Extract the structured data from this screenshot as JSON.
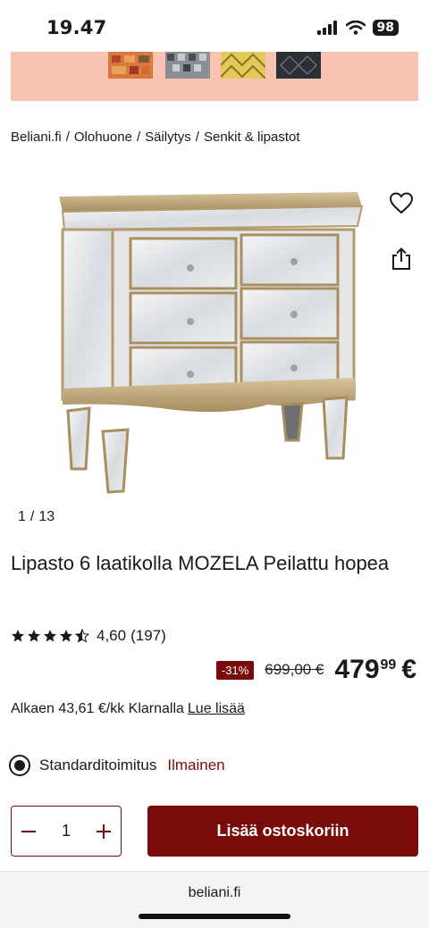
{
  "status_bar": {
    "time": "19.47",
    "battery": "98"
  },
  "breadcrumb": [
    "Beliani.fi",
    "/",
    "Olohuone",
    "/",
    "Säilytys",
    "/",
    "Senkit & lipastot"
  ],
  "gallery": {
    "current": "1",
    "separator": "/",
    "total": "13"
  },
  "product": {
    "title": "Lipasto 6 laatikolla MOZELA Peilattu hopea",
    "rating": "4,60",
    "reviews": "(197)",
    "rating_value": 4.6,
    "discount": "-31%",
    "old_price": "699,00 €",
    "price_main": "479",
    "price_cents": "99",
    "currency": "€"
  },
  "klarna": {
    "text": "Alkaen 43,61 €/kk Klarnalla",
    "link": "Lue lisää"
  },
  "shipping": {
    "label": "Standarditoimitus",
    "cost": "Ilmainen"
  },
  "cart": {
    "quantity": "1",
    "add_label": "Lisää ostoskoriin"
  },
  "footer": {
    "url": "beliani.fi"
  },
  "colors": {
    "brand": "#7a0b0b",
    "banner": "#f9c3b3"
  }
}
